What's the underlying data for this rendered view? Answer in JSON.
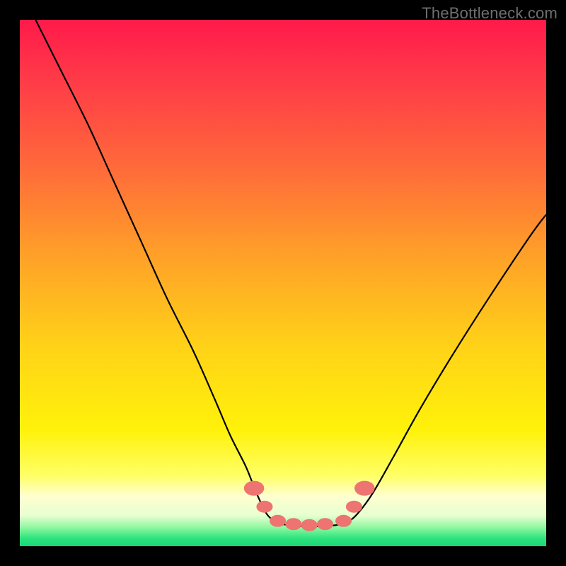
{
  "watermark": "TheBottleneck.com",
  "palette": {
    "frame": "#000000",
    "curve": "#000000",
    "marker_fill": "#ed7471",
    "marker_stroke": "#ed7471",
    "gradient_stops": [
      {
        "offset": 0.0,
        "color": "#ff1a4a"
      },
      {
        "offset": 0.12,
        "color": "#ff3c48"
      },
      {
        "offset": 0.28,
        "color": "#ff6a3a"
      },
      {
        "offset": 0.45,
        "color": "#ffa128"
      },
      {
        "offset": 0.62,
        "color": "#ffd218"
      },
      {
        "offset": 0.78,
        "color": "#fff20a"
      },
      {
        "offset": 0.866,
        "color": "#ffff66"
      },
      {
        "offset": 0.905,
        "color": "#ffffd0"
      },
      {
        "offset": 0.942,
        "color": "#e7ffd0"
      },
      {
        "offset": 0.965,
        "color": "#8cf7a0"
      },
      {
        "offset": 0.985,
        "color": "#2de37e"
      },
      {
        "offset": 1.0,
        "color": "#17d877"
      }
    ]
  },
  "chart_data": {
    "type": "line",
    "title": "",
    "xlabel": "",
    "ylabel": "",
    "xlim": [
      0,
      100
    ],
    "ylim": [
      0,
      100
    ],
    "note": "Single U-shaped bottleneck curve. y≈100 is the top (worst / red), y≈0 is the bottom (best / green). Minimum plateau roughly over x≈48–62 at y≈4. Values estimated from pixels.",
    "series": [
      {
        "name": "bottleneck-curve",
        "x": [
          3,
          8,
          13,
          18,
          23,
          28,
          33,
          37,
          40,
          43,
          45,
          47,
          49,
          51,
          54,
          57,
          60,
          62,
          64,
          67,
          71,
          76,
          82,
          89,
          97,
          100
        ],
        "y": [
          100,
          90,
          80,
          69,
          58,
          47,
          37,
          28,
          21,
          15,
          10,
          6,
          4.5,
          4,
          3.8,
          3.8,
          4,
          4.5,
          6,
          10,
          17,
          26,
          36,
          47,
          59,
          63
        ]
      }
    ],
    "markers": {
      "name": "highlighted-points",
      "x": [
        44.5,
        46.5,
        49,
        52,
        55,
        58,
        61.5,
        63.5,
        65.5
      ],
      "y": [
        11,
        7.5,
        4.8,
        4.2,
        4.0,
        4.2,
        4.8,
        7.5,
        11
      ]
    }
  }
}
